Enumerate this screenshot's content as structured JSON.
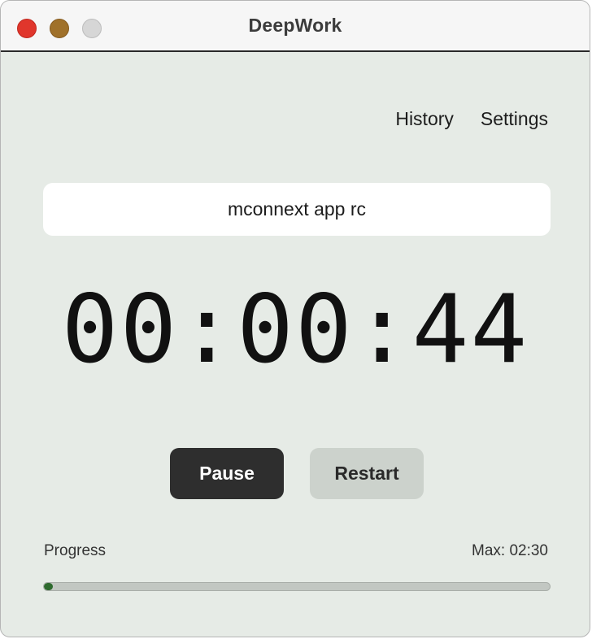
{
  "window": {
    "title": "DeepWork"
  },
  "nav": {
    "history": "History",
    "settings": "Settings"
  },
  "task": {
    "value": "mconnext app rc"
  },
  "timer": {
    "display": "00:00:44"
  },
  "controls": {
    "pause": "Pause",
    "restart": "Restart"
  },
  "progress": {
    "label": "Progress",
    "max_label": "Max: 02:30",
    "fraction": 0.0049
  },
  "colors": {
    "accent": "#2e6a2e",
    "close": "#e0362c",
    "minimize": "#a0712a",
    "zoom": "#d6d6d6"
  }
}
